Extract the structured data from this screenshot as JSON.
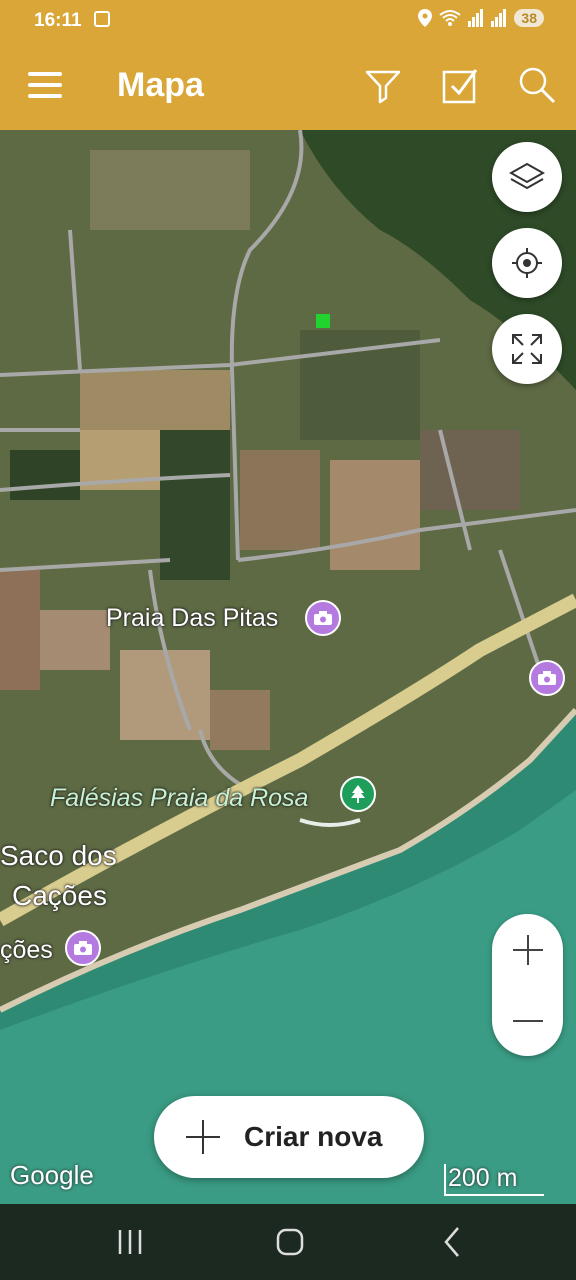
{
  "status_bar": {
    "time": "16:11",
    "battery": "38"
  },
  "app_bar": {
    "title": "Mapa",
    "icons": [
      "menu-icon",
      "filter-icon",
      "checkbox-icon",
      "search-icon"
    ]
  },
  "map": {
    "labels": {
      "praia_das_pitas": "Praia Das Pitas",
      "falesias": "Falésias Praia da Rosa",
      "saco_line1": "Saco dos",
      "saco_line2": "Cações",
      "cacoes_partial": "ções"
    },
    "attribution": "Google",
    "scale": "200 m"
  },
  "controls": {
    "layers": "layers-icon",
    "locate": "crosshair-icon",
    "fullscreen": "expand-icon",
    "zoom_in": "+",
    "zoom_out": "—"
  },
  "create_button": {
    "label": "Criar nova"
  },
  "colors": {
    "brand": "#d9a637",
    "poi_purple": "#b57ae0",
    "poi_green": "#1f9d5a",
    "sea": "#2f8a74"
  }
}
